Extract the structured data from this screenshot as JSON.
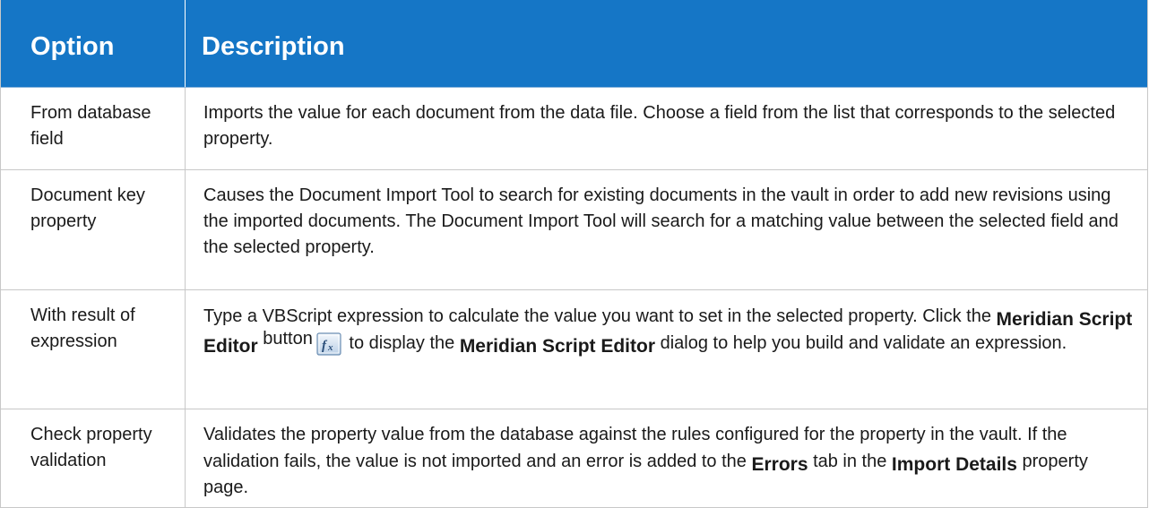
{
  "table": {
    "headers": {
      "option": "Option",
      "description": "Description"
    },
    "rows": [
      {
        "option": "From database field",
        "description": "Imports the value for each document from the data file. Choose a field from the list that corresponds to the selected property."
      },
      {
        "option": "Document key property",
        "description": "Causes the Document Import Tool to search for existing documents in the vault in order to add new revisions using the imported documents. The Document Import Tool will search for a matching value between the selected field and the selected property."
      },
      {
        "option": "With result of expression",
        "description": {
          "part1": "Type a VBScript expression to calculate the value you want to set in the selected property. Click the ",
          "term1": "Meridian Script Editor",
          "part2": " button",
          "icon": "function-editor-icon",
          "part3": " to display the ",
          "term2": "Meridian Script Editor",
          "part4": " dialog to help you build and validate an expression."
        }
      },
      {
        "option": "Check property validation",
        "description": {
          "part1": "Validates the property value from the database against the rules configured for the property in the vault. If the validation fails, the value is not imported and an error is added to the ",
          "term1": "Errors",
          "part2": " tab in the ",
          "term2": "Import Details",
          "part3": " property page."
        }
      }
    ]
  },
  "colors": {
    "header_bg": "#1576C6",
    "header_text": "#FFFFFF",
    "grid_lines": "#C8C8C8",
    "body_text": "#1A1A1A"
  }
}
